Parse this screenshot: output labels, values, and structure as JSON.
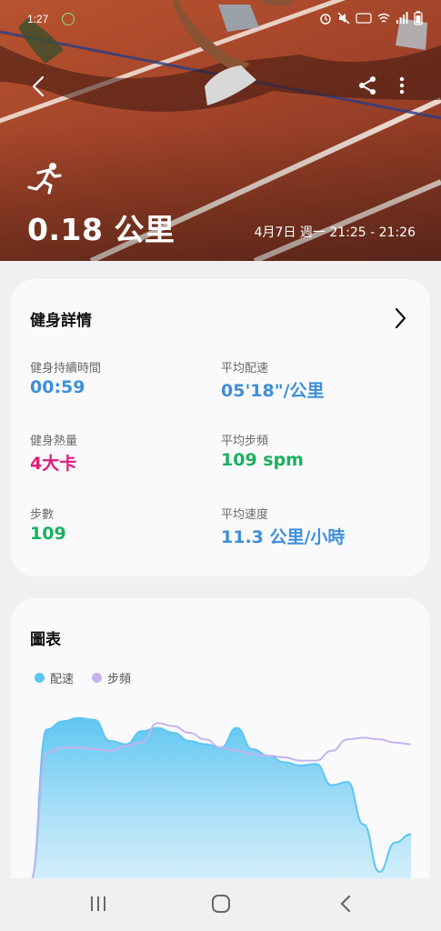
{
  "status": {
    "time": "1:27"
  },
  "header": {
    "distance": "0.18 公里",
    "datetime": "4月7日 週一 21:25 - 21:26"
  },
  "details": {
    "title": "健身詳情",
    "metrics": [
      {
        "label": "健身持續時間",
        "value": "00:59",
        "color": "#3d8fd9"
      },
      {
        "label": "平均配速",
        "value": "05'18\"/公里",
        "color": "#3d8fd9"
      },
      {
        "label": "健身熱量",
        "value": "4大卡",
        "color": "#e5187a"
      },
      {
        "label": "平均步頻",
        "value": "109 spm",
        "color": "#19b15f"
      },
      {
        "label": "步數",
        "value": "109",
        "color": "#19b15f"
      },
      {
        "label": "平均速度",
        "value": "11.3 公里/小時",
        "color": "#3d8fd9"
      }
    ]
  },
  "chart_section": {
    "title": "圖表",
    "legend": [
      {
        "label": "配速",
        "color": "#5cc6f2"
      },
      {
        "label": "步頻",
        "color": "#c5b3ea"
      }
    ]
  },
  "chart_data": {
    "type": "area",
    "series": [
      {
        "name": "配速",
        "values": [
          0,
          0.92,
          0.97,
          0.99,
          0.98,
          0.85,
          0.83,
          0.91,
          0.93,
          0.9,
          0.85,
          0.83,
          0.81,
          0.93,
          0.8,
          0.76,
          0.72,
          0.7,
          0.71,
          0.58,
          0.6,
          0.34,
          0.05,
          0.23,
          0.28
        ]
      },
      {
        "name": "步頻",
        "values": [
          0,
          0.78,
          0.81,
          0.81,
          0.8,
          0.79,
          0.82,
          0.84,
          0.96,
          0.94,
          0.9,
          0.86,
          0.81,
          0.79,
          0.77,
          0.76,
          0.75,
          0.73,
          0.73,
          0.79,
          0.86,
          0.87,
          0.86,
          0.84,
          0.83
        ]
      }
    ]
  }
}
